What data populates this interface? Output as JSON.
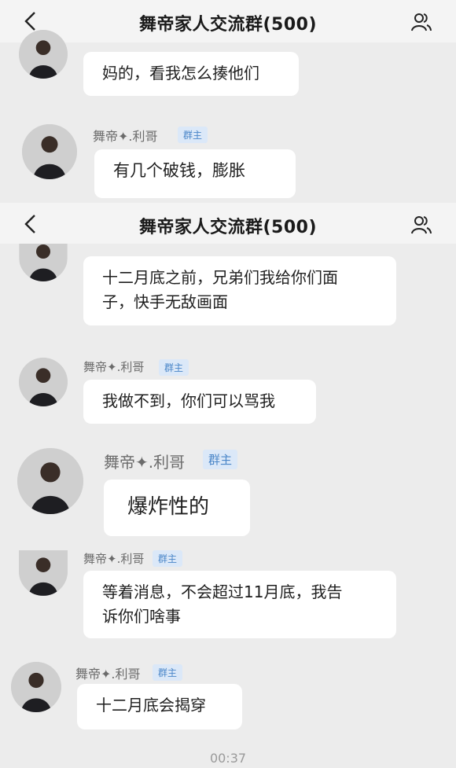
{
  "header": {
    "title": "舞帝家人交流群(500)"
  },
  "messages": [
    {
      "sender": "",
      "badge": "",
      "lines": [
        "妈的，看我怎么揍他们"
      ]
    },
    {
      "sender": "舞帝✦.利哥",
      "badge": "群主",
      "lines": [
        "有几个破钱，膨胀"
      ]
    },
    {
      "sender": "",
      "badge": "",
      "lines": [
        "十二月底之前，兄弟们我给你们面",
        "子，快手无敌画面"
      ]
    },
    {
      "sender": "舞帝✦.利哥",
      "badge": "群主",
      "lines": [
        "我做不到，你们可以骂我"
      ]
    },
    {
      "sender": "舞帝✦.利哥",
      "badge": "群主",
      "lines": [
        "爆炸性的"
      ]
    },
    {
      "sender": "舞帝✦.利哥",
      "badge": "群主",
      "lines": [
        "等着消息，不会超过11月底，我告",
        "诉你们啥事"
      ]
    },
    {
      "sender": "舞帝✦.利哥",
      "badge": "群主",
      "lines": [
        "十二月底会揭穿"
      ]
    }
  ],
  "timestamp": "00:37",
  "icons": {
    "back": "chevron-left-icon",
    "members": "group-members-icon"
  },
  "colors": {
    "badge_bg": "#dbe8f8",
    "badge_text": "#4a86c8",
    "bubble": "#ffffff",
    "background": "#ececec"
  }
}
